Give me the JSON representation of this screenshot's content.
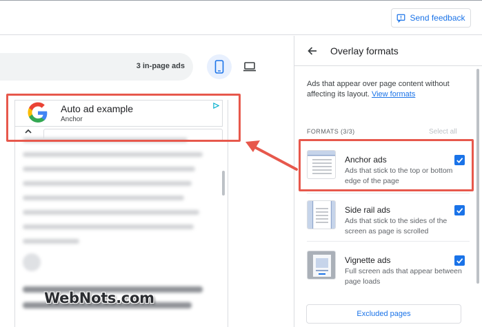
{
  "topbar": {
    "feedback_label": "Send feedback",
    "feedback_icon": "feedback-icon"
  },
  "preview": {
    "ads_count": "3 in-page ads",
    "device_mobile_icon": "smartphone-icon",
    "device_desktop_icon": "laptop-icon",
    "anchor_ad": {
      "title": "Auto ad example",
      "subtitle": "Anchor",
      "logo": "google-logo",
      "adchoices_icon": "adchoices-icon"
    }
  },
  "watermark": "WebNots.com",
  "panel": {
    "title": "Overlay formats",
    "description": "Ads that appear over page content without affecting its layout.",
    "description_link": "View formats",
    "formats_label": "FORMATS (3/3)",
    "select_all": "Select all",
    "formats": [
      {
        "name": "Anchor ads",
        "desc": "Ads that stick to the top or bottom edge of the page",
        "checked": true
      },
      {
        "name": "Side rail ads",
        "desc": "Ads that stick to the sides of the screen as page is scrolled",
        "checked": true
      },
      {
        "name": "Vignette ads",
        "desc": "Full screen ads that appear between page loads",
        "checked": true
      }
    ],
    "excluded_pages": "Excluded pages"
  },
  "colors": {
    "accent": "#1a73e8",
    "annotation": "#e7584c",
    "selected_device_bg": "#e8f0fe"
  }
}
